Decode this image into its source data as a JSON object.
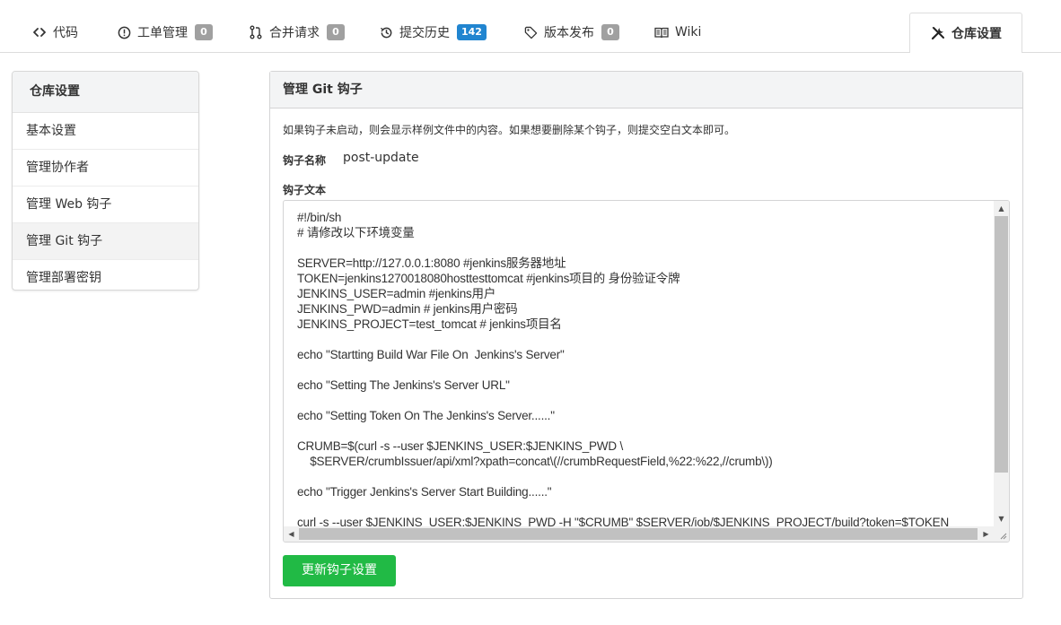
{
  "tabs": [
    {
      "label": "代码",
      "icon": "code-icon"
    },
    {
      "label": "工单管理",
      "icon": "issue-icon",
      "badge": "0"
    },
    {
      "label": "合并请求",
      "icon": "pull-request-icon",
      "badge": "0"
    },
    {
      "label": "提交历史",
      "icon": "history-icon",
      "badge": "142",
      "badge_color": "#2185d0"
    },
    {
      "label": "版本发布",
      "icon": "tag-icon",
      "badge": "0"
    },
    {
      "label": "Wiki",
      "icon": "book-icon"
    },
    {
      "label": "仓库设置",
      "icon": "tools-icon",
      "active": true
    }
  ],
  "sidebar": {
    "title": "仓库设置",
    "items": [
      {
        "label": "基本设置"
      },
      {
        "label": "管理协作者"
      },
      {
        "label": "管理 Web 钩子"
      },
      {
        "label": "管理 Git 钩子",
        "selected": true
      },
      {
        "label": "管理部署密钥"
      }
    ]
  },
  "panel": {
    "title": "管理 Git 钩子",
    "description": "如果钩子未启动，则会显示样例文件中的内容。如果想要删除某个钩子，则提交空白文本即可。",
    "hook_name_label": "钩子名称",
    "hook_name": "post-update",
    "content_label": "钩子文本",
    "content": "#!/bin/sh\n# 请修改以下环境变量\n\nSERVER=http://127.0.0.1:8080 #jenkins服务器地址\nTOKEN=jenkins1270018080hosttesttomcat #jenkins项目的 身份验证令牌\nJENKINS_USER=admin #jenkins用户\nJENKINS_PWD=admin # jenkins用户密码\nJENKINS_PROJECT=test_tomcat # jenkins项目名\n\necho \"Startting Build War File On  Jenkins's Server\"\n\necho \"Setting The Jenkins's Server URL\"\n\necho \"Setting Token On The Jenkins's Server......\"\n\nCRUMB=$(curl -s --user $JENKINS_USER:$JENKINS_PWD \\\n    $SERVER/crumbIssuer/api/xml?xpath=concat\\(//crumbRequestField,%22:%22,//crumb\\))\n\necho \"Trigger Jenkins's Server Start Building......\"\n\ncurl -s --user $JENKINS_USER:$JENKINS_PWD -H \"$CRUMB\" $SERVER/job/$JENKINS_PROJECT/build?token=$TOKEN",
    "submit_label": "更新钩子设置"
  },
  "colors": {
    "accent_green": "#21ba45",
    "badge_blue": "#2185d0",
    "badge_grey": "#a0a0a0"
  }
}
